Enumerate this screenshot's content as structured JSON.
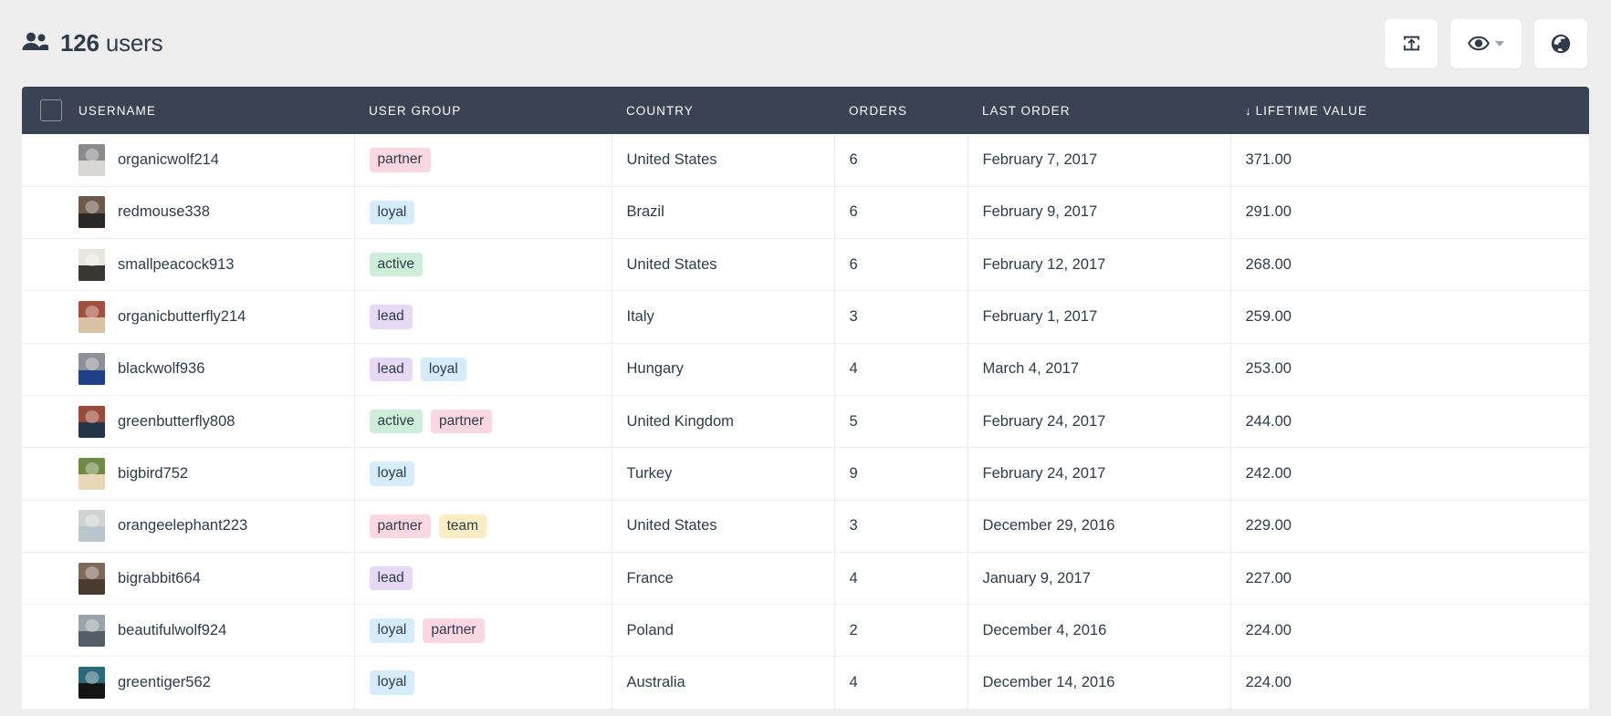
{
  "header": {
    "icon": "people-icon",
    "count": "126",
    "label": "users",
    "buttons": [
      {
        "name": "export-button",
        "icon": "export-upload-icon",
        "label": ""
      },
      {
        "name": "visibility-button",
        "icon": "eye-icon",
        "label": ""
      },
      {
        "name": "globe-button",
        "icon": "globe-icon",
        "label": ""
      }
    ]
  },
  "table": {
    "select_all": "",
    "columns": [
      {
        "key": "username",
        "label": "USERNAME",
        "sorted": false,
        "sort_dir": ""
      },
      {
        "key": "usergroup",
        "label": "USER GROUP",
        "sorted": false,
        "sort_dir": ""
      },
      {
        "key": "country",
        "label": "COUNTRY",
        "sorted": false,
        "sort_dir": ""
      },
      {
        "key": "orders",
        "label": "ORDERS",
        "sorted": false,
        "sort_dir": ""
      },
      {
        "key": "lastorder",
        "label": "LAST ORDER",
        "sorted": false,
        "sort_dir": ""
      },
      {
        "key": "ltv",
        "label": "LIFETIME VALUE",
        "sorted": true,
        "sort_dir": "↓"
      }
    ],
    "rows": [
      {
        "username": "organicwolf214",
        "tags": [
          {
            "label": "partner",
            "color": "#fbd7e1"
          }
        ],
        "country": "United States",
        "orders": "6",
        "last_order": "February 7, 2017",
        "lifetime_value": "371.00",
        "avatar_colors": [
          "#8a8a8c",
          "#d8d7d4"
        ]
      },
      {
        "username": "redmouse338",
        "tags": [
          {
            "label": "loyal",
            "color": "#d4ecfb"
          }
        ],
        "country": "Brazil",
        "orders": "6",
        "last_order": "February 9, 2017",
        "lifetime_value": "291.00",
        "avatar_colors": [
          "#6d5a4d",
          "#2b2724"
        ]
      },
      {
        "username": "smallpeacock913",
        "tags": [
          {
            "label": "active",
            "color": "#cdeed8"
          }
        ],
        "country": "United States",
        "orders": "6",
        "last_order": "February 12, 2017",
        "lifetime_value": "268.00",
        "avatar_colors": [
          "#e9e6e2",
          "#3a3733"
        ]
      },
      {
        "username": "organicbutterfly214",
        "tags": [
          {
            "label": "lead",
            "color": "#e5d9f7"
          }
        ],
        "country": "Italy",
        "orders": "3",
        "last_order": "February 1, 2017",
        "lifetime_value": "259.00",
        "avatar_colors": [
          "#a0513e",
          "#d9c1a4"
        ]
      },
      {
        "username": "blackwolf936",
        "tags": [
          {
            "label": "lead",
            "color": "#e5d9f7"
          },
          {
            "label": "loyal",
            "color": "#d4ecfb"
          }
        ],
        "country": "Hungary",
        "orders": "4",
        "last_order": "March 4, 2017",
        "lifetime_value": "253.00",
        "avatar_colors": [
          "#8e9099",
          "#1f3f86"
        ]
      },
      {
        "username": "greenbutterfly808",
        "tags": [
          {
            "label": "active",
            "color": "#cdeed8"
          },
          {
            "label": "partner",
            "color": "#fbd7e1"
          }
        ],
        "country": "United Kingdom",
        "orders": "5",
        "last_order": "February 24, 2017",
        "lifetime_value": "244.00",
        "avatar_colors": [
          "#9a4b39",
          "#26344a"
        ]
      },
      {
        "username": "bigbird752",
        "tags": [
          {
            "label": "loyal",
            "color": "#d4ecfb"
          }
        ],
        "country": "Turkey",
        "orders": "9",
        "last_order": "February 24, 2017",
        "lifetime_value": "242.00",
        "avatar_colors": [
          "#6f8a46",
          "#e9d9b8"
        ]
      },
      {
        "username": "orangeelephant223",
        "tags": [
          {
            "label": "partner",
            "color": "#fbd7e1"
          },
          {
            "label": "team",
            "color": "#fbeec4"
          }
        ],
        "country": "United States",
        "orders": "3",
        "last_order": "December 29, 2016",
        "lifetime_value": "229.00",
        "avatar_colors": [
          "#cfd3d2",
          "#b8c6cc"
        ]
      },
      {
        "username": "bigrabbit664",
        "tags": [
          {
            "label": "lead",
            "color": "#e5d9f7"
          }
        ],
        "country": "France",
        "orders": "4",
        "last_order": "January 9, 2017",
        "lifetime_value": "227.00",
        "avatar_colors": [
          "#7d6a5c",
          "#4a3b30"
        ]
      },
      {
        "username": "beautifulwolf924",
        "tags": [
          {
            "label": "loyal",
            "color": "#d4ecfb"
          },
          {
            "label": "partner",
            "color": "#fbd7e1"
          }
        ],
        "country": "Poland",
        "orders": "2",
        "last_order": "December 4, 2016",
        "lifetime_value": "224.00",
        "avatar_colors": [
          "#9ba4ab",
          "#555e66"
        ]
      },
      {
        "username": "greentiger562",
        "tags": [
          {
            "label": "loyal",
            "color": "#d4ecfb"
          }
        ],
        "country": "Australia",
        "orders": "4",
        "last_order": "December 14, 2016",
        "lifetime_value": "224.00",
        "avatar_colors": [
          "#2b6a7a",
          "#141414"
        ]
      }
    ]
  },
  "colors": {
    "page_bg": "#eeeeee",
    "table_header_bg": "#394353",
    "text": "#2f3b49",
    "row_border": "#edeef0"
  }
}
